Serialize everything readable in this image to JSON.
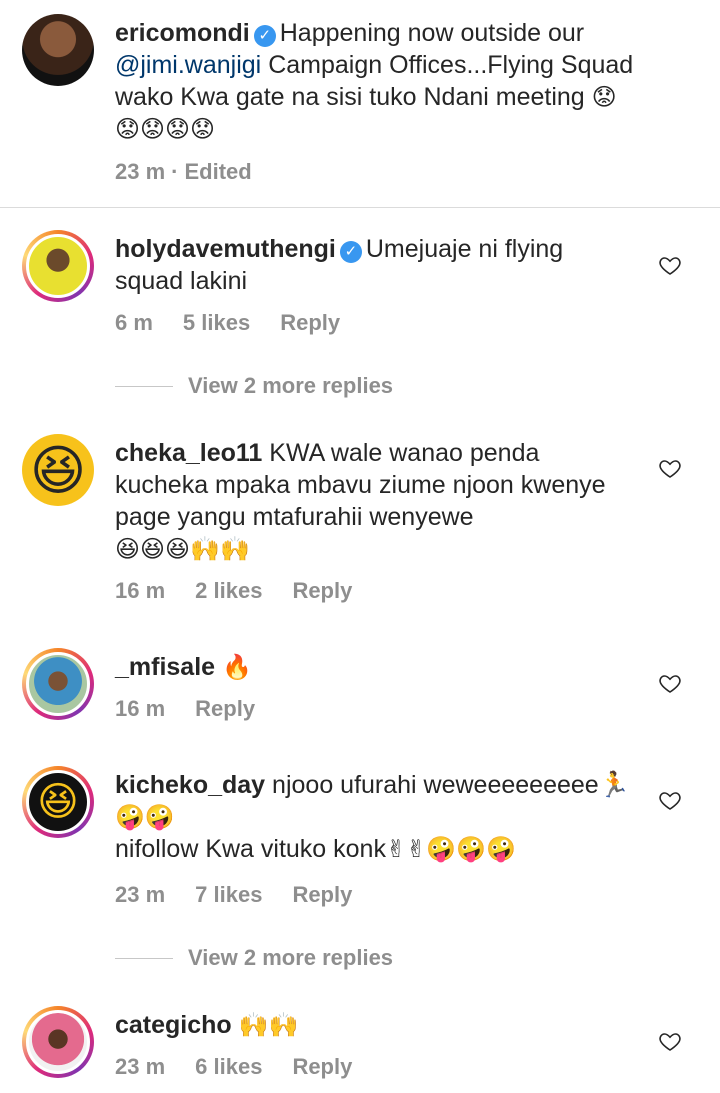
{
  "post": {
    "username": "ericomondi",
    "verified_mark": "✓",
    "caption_before": "Happening now outside our ",
    "mention": "@jimi.wanjigi",
    "caption_after": " Campaign Offices...Flying Squad wako Kwa gate na sisi tuko Ndani meeting ",
    "emojis": "😟😟😟😟😟",
    "time": "23 m",
    "separator": "·",
    "edited": "Edited"
  },
  "comments": [
    {
      "username": "holydavemuthengi",
      "verified": true,
      "text": "Umejuaje ni flying squad lakini",
      "time": "6 m",
      "likes": "5 likes",
      "reply": "Reply",
      "view_more": "View 2 more replies"
    },
    {
      "username": "cheka_leo11",
      "text": "KWA wale wanao penda kucheka mpaka mbavu ziume njoon kwenye page yangu mtafurahii wenyewe",
      "emojis": "😆😆😆🙌🙌",
      "time": "16 m",
      "likes": "2 likes",
      "reply": "Reply"
    },
    {
      "username": "_mfisale",
      "text": "",
      "emojis": "🔥",
      "time": "16 m",
      "reply": "Reply"
    },
    {
      "username": "kicheko_day",
      "text": "njooo ufurahi weweeeeeeeee🏃",
      "emojis_line2": "🤪🤪",
      "text_line3": "nifollow Kwa vituko konk",
      "emojis_line3": "✌✌🤪🤪🤪",
      "time": "23 m",
      "likes": "7 likes",
      "reply": "Reply",
      "view_more": "View 2 more replies"
    },
    {
      "username": "categicho",
      "text": "",
      "emojis": "🙌🙌",
      "time": "23 m",
      "likes": "6 likes",
      "reply": "Reply"
    }
  ],
  "icons": {
    "like": "heart-outline-icon",
    "verified": "verified-badge-icon"
  },
  "colors": {
    "username": "#262626",
    "meta": "#8e8e8e",
    "mention": "#00376b",
    "verified": "#3897f0"
  }
}
